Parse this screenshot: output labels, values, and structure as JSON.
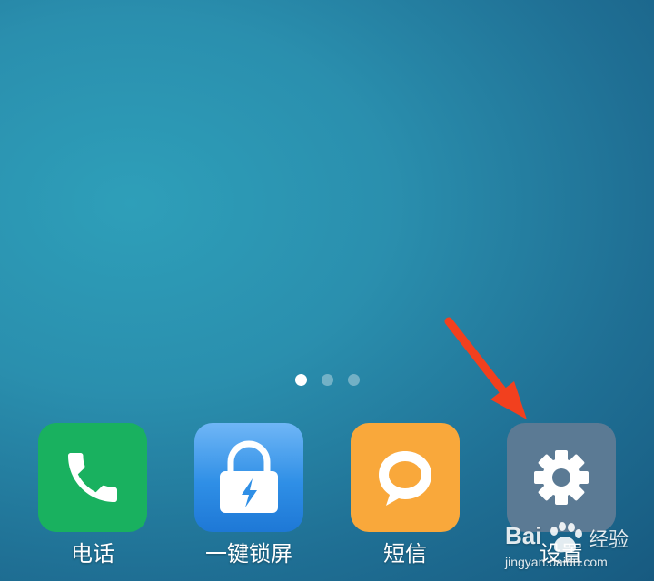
{
  "colors": {
    "phone": "#19b15f",
    "lock": "#2f8fe6",
    "sms": "#f9a83b",
    "settings": "#5b7a94",
    "arrow": "#f2401e"
  },
  "pager": {
    "pages": 3,
    "active_index": 0
  },
  "dock": {
    "apps": [
      {
        "label": "电话",
        "icon": "phone-icon"
      },
      {
        "label": "一键锁屏",
        "icon": "lock-icon"
      },
      {
        "label": "短信",
        "icon": "chat-bubble-icon"
      },
      {
        "label": "设置",
        "icon": "gear-icon"
      }
    ]
  },
  "watermark": {
    "brand": "Bai",
    "jingyan": "经验",
    "url": "jingyan.baidu.com"
  }
}
